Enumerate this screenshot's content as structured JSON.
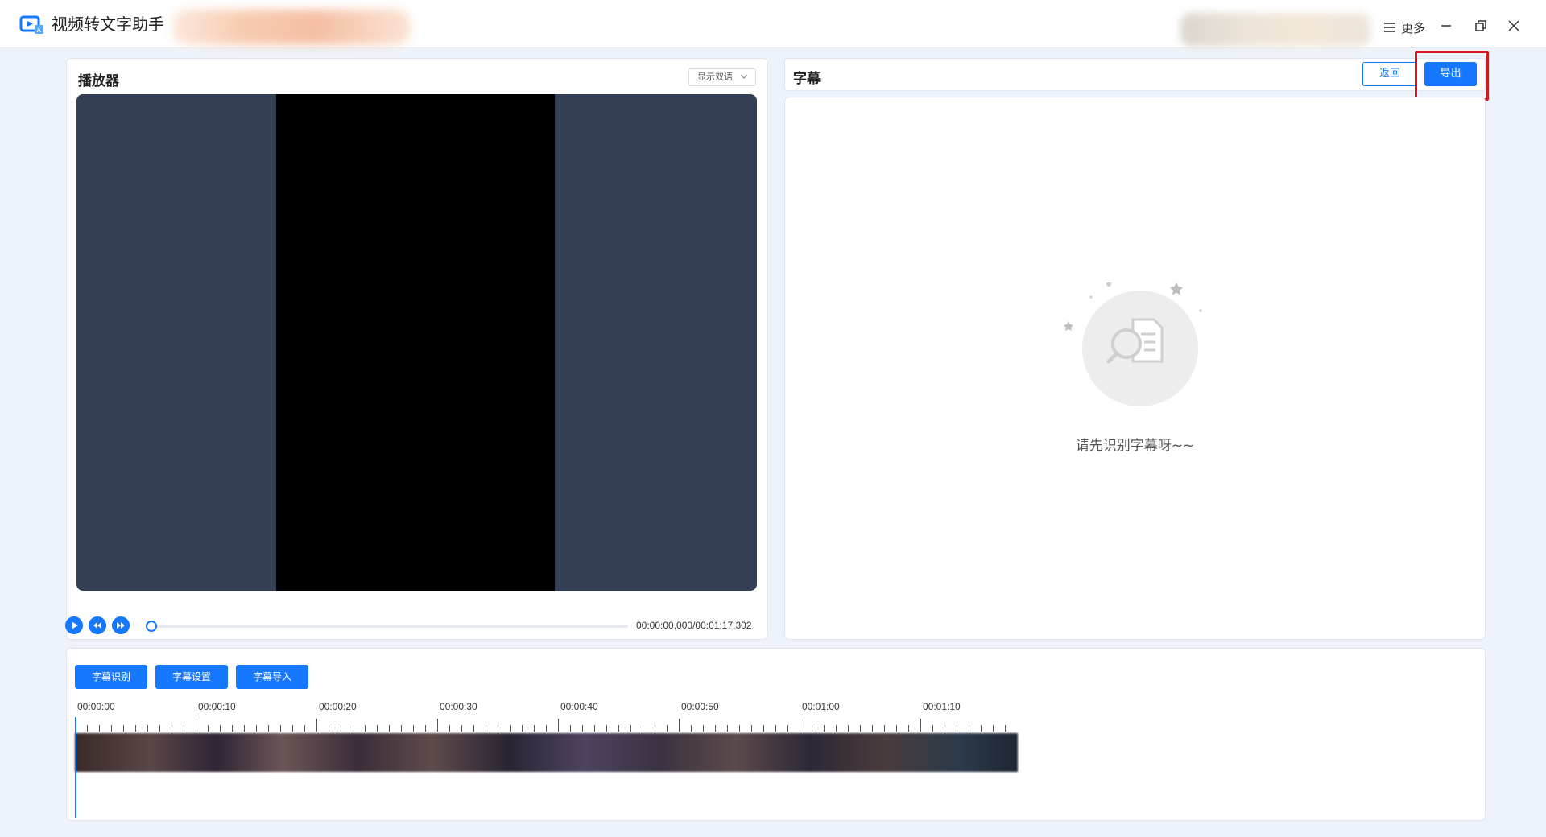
{
  "app": {
    "title": "视频转文字助手",
    "more_label": "更多"
  },
  "player": {
    "title": "播放器",
    "language_select": "显示双语",
    "time_readout": "00:00:00,000/00:01:17,302",
    "progress": 0
  },
  "subtitle": {
    "title": "字幕",
    "back_label": "返回",
    "export_label": "导出",
    "empty_text": "请先识别字幕呀~~"
  },
  "timeline": {
    "buttons": [
      "字幕识别",
      "字幕设置",
      "字幕导入"
    ],
    "tick_labels": [
      "00:00:00",
      "00:00:10",
      "00:00:20",
      "00:00:30",
      "00:00:40",
      "00:00:50",
      "00:01:00",
      "00:01:10"
    ]
  },
  "colors": {
    "accent": "#1677ff",
    "video_bg": "#323f55",
    "highlight": "#d9161c"
  }
}
